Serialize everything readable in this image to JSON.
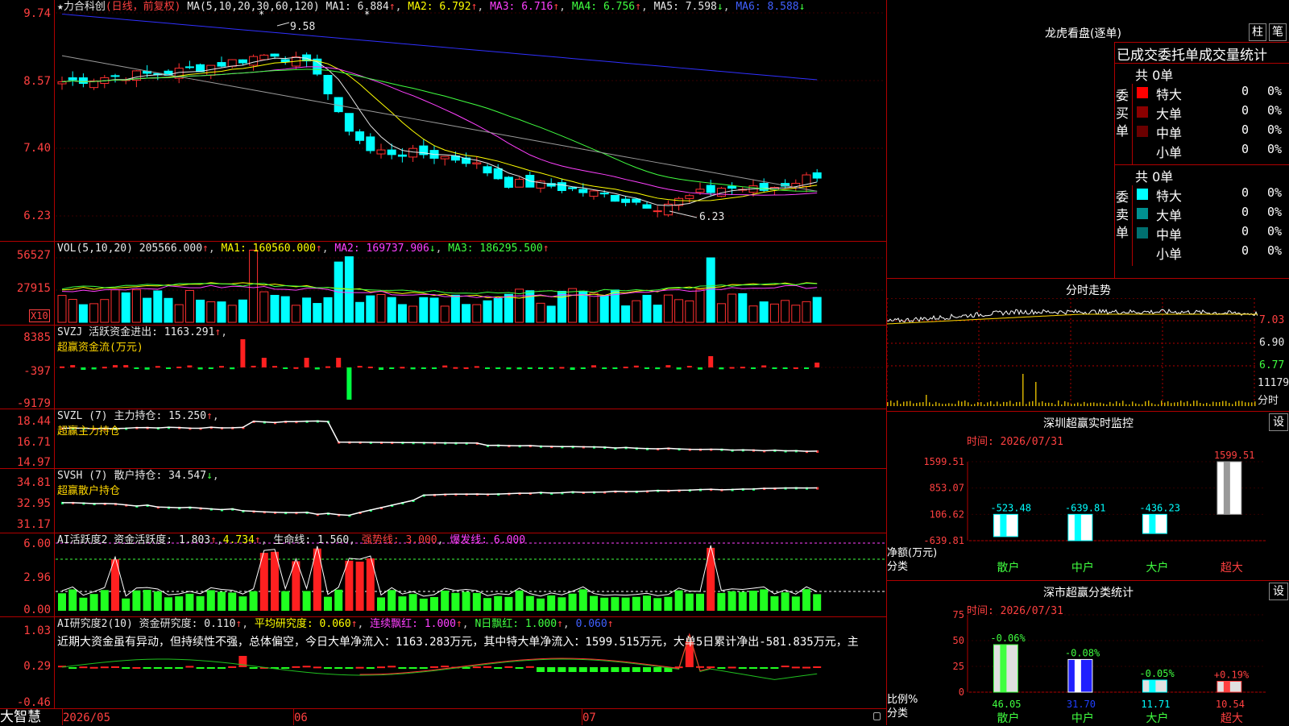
{
  "app": {
    "logo": "大智慧"
  },
  "kline": {
    "star": "★",
    "name": "力合科创",
    "mode": "(日线，前复权)",
    "ma_label": "MA(5,10,20,30,60,120)",
    "ma1": "MA1: 6.884",
    "ma2": "MA2: 6.792",
    "ma3": "MA3: 6.716",
    "ma4": "MA4: 6.756",
    "ma5": "MA5: 7.598",
    "ma6": "MA6: 8.588",
    "yaxis": [
      "9.74",
      "8.57",
      "7.40",
      "6.23"
    ],
    "high_label": "9.58",
    "low_label": "6.23",
    "ma_colors": {
      "ma1": "#e8e8e8",
      "ma2": "#ffff00",
      "ma3": "#ff40ff",
      "ma4": "#40ff40",
      "ma5": "#9a9a9a",
      "ma6": "#3030ff"
    }
  },
  "vol": {
    "label": "VOL(5,10,20)",
    "value": "205566.000",
    "ma1": "MA1: 160560.000",
    "ma2": "MA2: 169737.906",
    "ma3": "MA3: 186295.500",
    "yaxis": [
      "56527",
      "27915"
    ],
    "unit": "X10"
  },
  "svzj": {
    "label": "SVZJ  活跃资金进出: 1163.291",
    "sub": "超赢资金流(万元)",
    "yaxis": [
      "8385",
      "-397",
      "-9179"
    ]
  },
  "svzl": {
    "label": "SVZL (7) 主力持仓: 15.250",
    "sub": "超赢主力持仓",
    "yaxis": [
      "18.44",
      "16.71",
      "14.97"
    ]
  },
  "svsh": {
    "label": "SVSH (7) 散户持仓: 34.547",
    "sub": "超赢散户持仓",
    "yaxis": [
      "34.81",
      "32.95",
      "31.17"
    ]
  },
  "ai1": {
    "label": "AI活跃度2 资金活跃度: 1.803",
    "v2": "4.734",
    "life": "生命线: 1.560",
    "strong": "强势线: 3.000",
    "burst": "爆发线: 6.000",
    "yaxis": [
      "6.00",
      "2.96",
      "0.00"
    ]
  },
  "ai2": {
    "label": "AI研究度2(10) 资金研究度: 0.110",
    "avg": "平均研究度: 0.060",
    "cont": "连续飘红: 1.000",
    "nday": "N日飘红: 1.000",
    "last": "0.060",
    "yaxis": [
      "1.03",
      "0.29",
      "-0.46"
    ],
    "comment": "近期大资金虽有异动，但持续性不强，总体偏空，今日大单净流入：1163.283万元，其中特大单净流入：1599.515万元，大单5日累计净出-581.835万元，主"
  },
  "xaxis": {
    "labels": [
      "2026/05",
      "06",
      "07"
    ]
  },
  "lhb": {
    "title": "龙虎看盘(逐单)",
    "btn1": "柱",
    "btn2": "笔",
    "header": "已成交委托单成交量统计",
    "buy": {
      "side": "委买单",
      "total": "共 0单",
      "rows": [
        {
          "label": "特大",
          "n": "0",
          "p": "0%",
          "color": "#ff0000"
        },
        {
          "label": "大单",
          "n": "0",
          "p": "0%",
          "color": "#8b0000"
        },
        {
          "label": "中单",
          "n": "0",
          "p": "0%",
          "color": "#6a0000"
        },
        {
          "label": "小单",
          "n": "0",
          "p": "0%",
          "color": ""
        }
      ]
    },
    "sell": {
      "side": "委卖单",
      "total": "共 0单",
      "rows": [
        {
          "label": "特大",
          "n": "0",
          "p": "0%",
          "color": "#00ffff"
        },
        {
          "label": "大单",
          "n": "0",
          "p": "0%",
          "color": "#009090"
        },
        {
          "label": "中单",
          "n": "0",
          "p": "0%",
          "color": "#007070"
        },
        {
          "label": "小单",
          "n": "0",
          "p": "0%",
          "color": ""
        }
      ]
    }
  },
  "fenshi": {
    "title": "分时走势",
    "yaxis": [
      "7.03",
      "6.90",
      "6.77"
    ],
    "vol": "11179",
    "vol_label": "分时"
  },
  "sz_monitor": {
    "title": "深圳超赢实时监控",
    "btn": "设",
    "time": "时间: 2026/07/31",
    "yaxis": [
      "1599.51",
      "853.07",
      "106.62",
      "-639.81"
    ],
    "ylabel1": "净额(万元)",
    "ylabel2": "分类",
    "cats": [
      "散户",
      "中户",
      "大户",
      "超大"
    ],
    "values": [
      -523.48,
      -639.81,
      -436.23,
      1599.51
    ],
    "value_labels": [
      "-523.48",
      "-639.81",
      "-436.23",
      "1599.51"
    ]
  },
  "sz_stats": {
    "title": "深市超赢分类统计",
    "btn": "设",
    "time": "时间: 2026/07/31",
    "yaxis": [
      "75",
      "50",
      "25",
      "0"
    ],
    "ylabel1": "比例%",
    "ylabel2": "分类",
    "cats": [
      "散户",
      "中户",
      "大户",
      "超大"
    ],
    "values": [
      46.05,
      31.7,
      11.71,
      10.54
    ],
    "value_labels": [
      "46.05",
      "31.70",
      "11.71",
      "10.54"
    ],
    "changes": [
      "-0.06%",
      "-0.08%",
      "-0.05%",
      "+0.19%"
    ]
  }
}
